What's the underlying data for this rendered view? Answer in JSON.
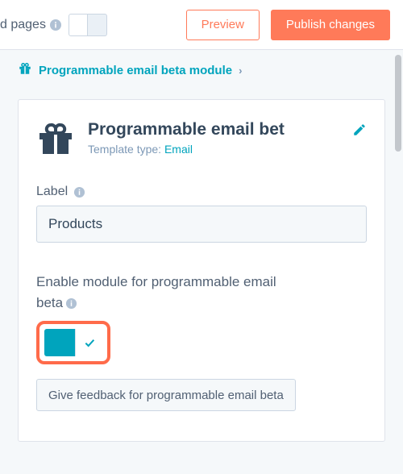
{
  "topbar": {
    "pages_fragment": "d pages",
    "preview_label": "Preview",
    "publish_label": "Publish changes"
  },
  "breadcrumb": {
    "label": "Programmable email beta module"
  },
  "module": {
    "title": "Programmable email bet",
    "subtitle_prefix": "Template type: ",
    "subtitle_link": "Email"
  },
  "label_field": {
    "label": "Label",
    "value": "Products"
  },
  "enable": {
    "text_line1": "Enable module for programmable email",
    "text_line2": "beta"
  },
  "feedback": {
    "label": "Give feedback for programmable email beta"
  }
}
